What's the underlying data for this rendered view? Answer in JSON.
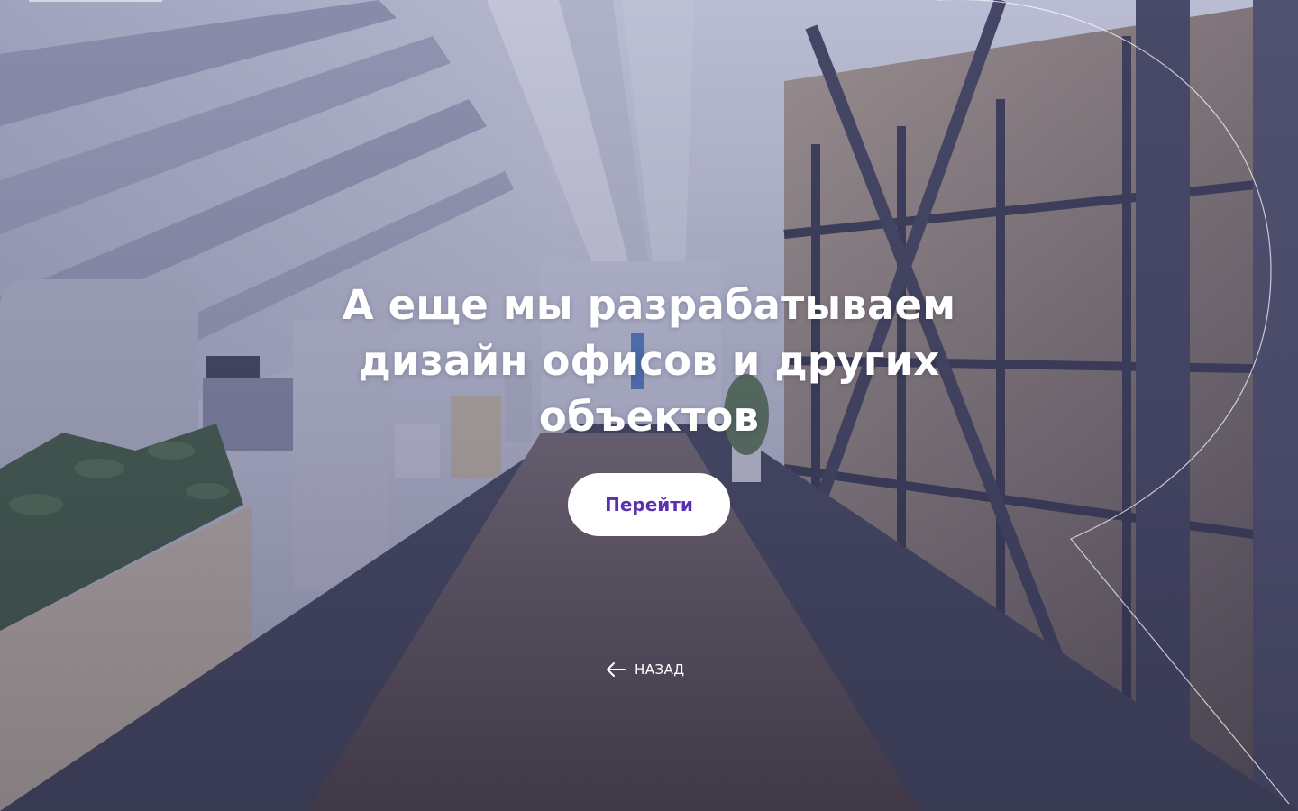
{
  "hero": {
    "title_lines": [
      "А еще мы разрабатываем",
      "дизайн офисов и других",
      "объектов"
    ],
    "cta_label": "Перейти",
    "back_label": "НАЗАД",
    "back_icon": "arrow-left-icon"
  },
  "colors": {
    "overlay": "#5c6096",
    "cta_background": "#ffffff",
    "cta_text": "#5b2fb3",
    "text": "#ffffff"
  }
}
